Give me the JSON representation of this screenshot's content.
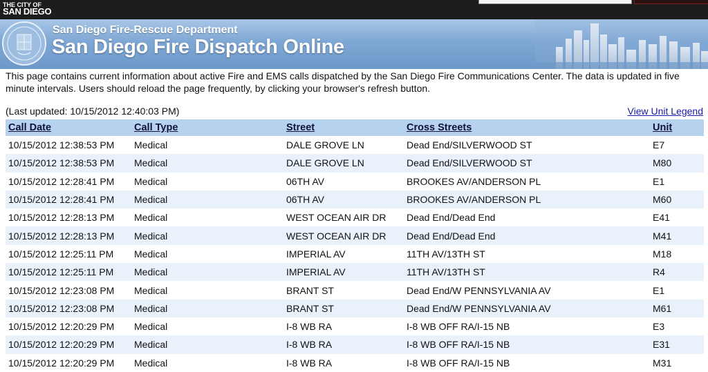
{
  "header": {
    "city_small": "THE CITY OF",
    "city_big": "SAN DIEGO",
    "department": "San Diego Fire-Rescue Department",
    "title": "San Diego Fire Dispatch Online"
  },
  "intro": "This page contains current information about active Fire and EMS calls dispatched by the San Diego Fire Communications Center. The data is updated in five minute intervals. Users should reload the page frequently, by clicking your browser's refresh button.",
  "last_updated": "(Last updated: 10/15/2012 12:40:03 PM)",
  "legend_link": "View Unit Legend",
  "table": {
    "columns": [
      "Call Date",
      "Call Type",
      "Street",
      "Cross Streets",
      "Unit"
    ],
    "rows": [
      [
        "10/15/2012 12:38:53 PM",
        "Medical",
        "DALE GROVE LN",
        "Dead End/SILVERWOOD ST",
        "E7"
      ],
      [
        "10/15/2012 12:38:53 PM",
        "Medical",
        "DALE GROVE LN",
        "Dead End/SILVERWOOD ST",
        "M80"
      ],
      [
        "10/15/2012 12:28:41 PM",
        "Medical",
        "06TH AV",
        "BROOKES AV/ANDERSON PL",
        "E1"
      ],
      [
        "10/15/2012 12:28:41 PM",
        "Medical",
        "06TH AV",
        "BROOKES AV/ANDERSON PL",
        "M60"
      ],
      [
        "10/15/2012 12:28:13 PM",
        "Medical",
        "WEST OCEAN AIR DR",
        "Dead End/Dead End",
        "E41"
      ],
      [
        "10/15/2012 12:28:13 PM",
        "Medical",
        "WEST OCEAN AIR DR",
        "Dead End/Dead End",
        "M41"
      ],
      [
        "10/15/2012 12:25:11 PM",
        "Medical",
        "IMPERIAL AV",
        "11TH AV/13TH ST",
        "M18"
      ],
      [
        "10/15/2012 12:25:11 PM",
        "Medical",
        "IMPERIAL AV",
        "11TH AV/13TH ST",
        "R4"
      ],
      [
        "10/15/2012 12:23:08 PM",
        "Medical",
        "BRANT ST",
        "Dead End/W PENNSYLVANIA AV",
        "E1"
      ],
      [
        "10/15/2012 12:23:08 PM",
        "Medical",
        "BRANT ST",
        "Dead End/W PENNSYLVANIA AV",
        "M61"
      ],
      [
        "10/15/2012 12:20:29 PM",
        "Medical",
        "I-8 WB RA",
        "I-8 WB OFF RA/I-15 NB",
        "E3"
      ],
      [
        "10/15/2012 12:20:29 PM",
        "Medical",
        "I-8 WB RA",
        "I-8 WB OFF RA/I-15 NB",
        "E31"
      ],
      [
        "10/15/2012 12:20:29 PM",
        "Medical",
        "I-8 WB RA",
        "I-8 WB OFF RA/I-15 NB",
        "M31"
      ]
    ]
  },
  "colors": {
    "banner_blue": "#7ea7d4",
    "header_row": "#b7d2ee",
    "alt_row": "#e9f1fa",
    "link": "#1a1aa6"
  }
}
